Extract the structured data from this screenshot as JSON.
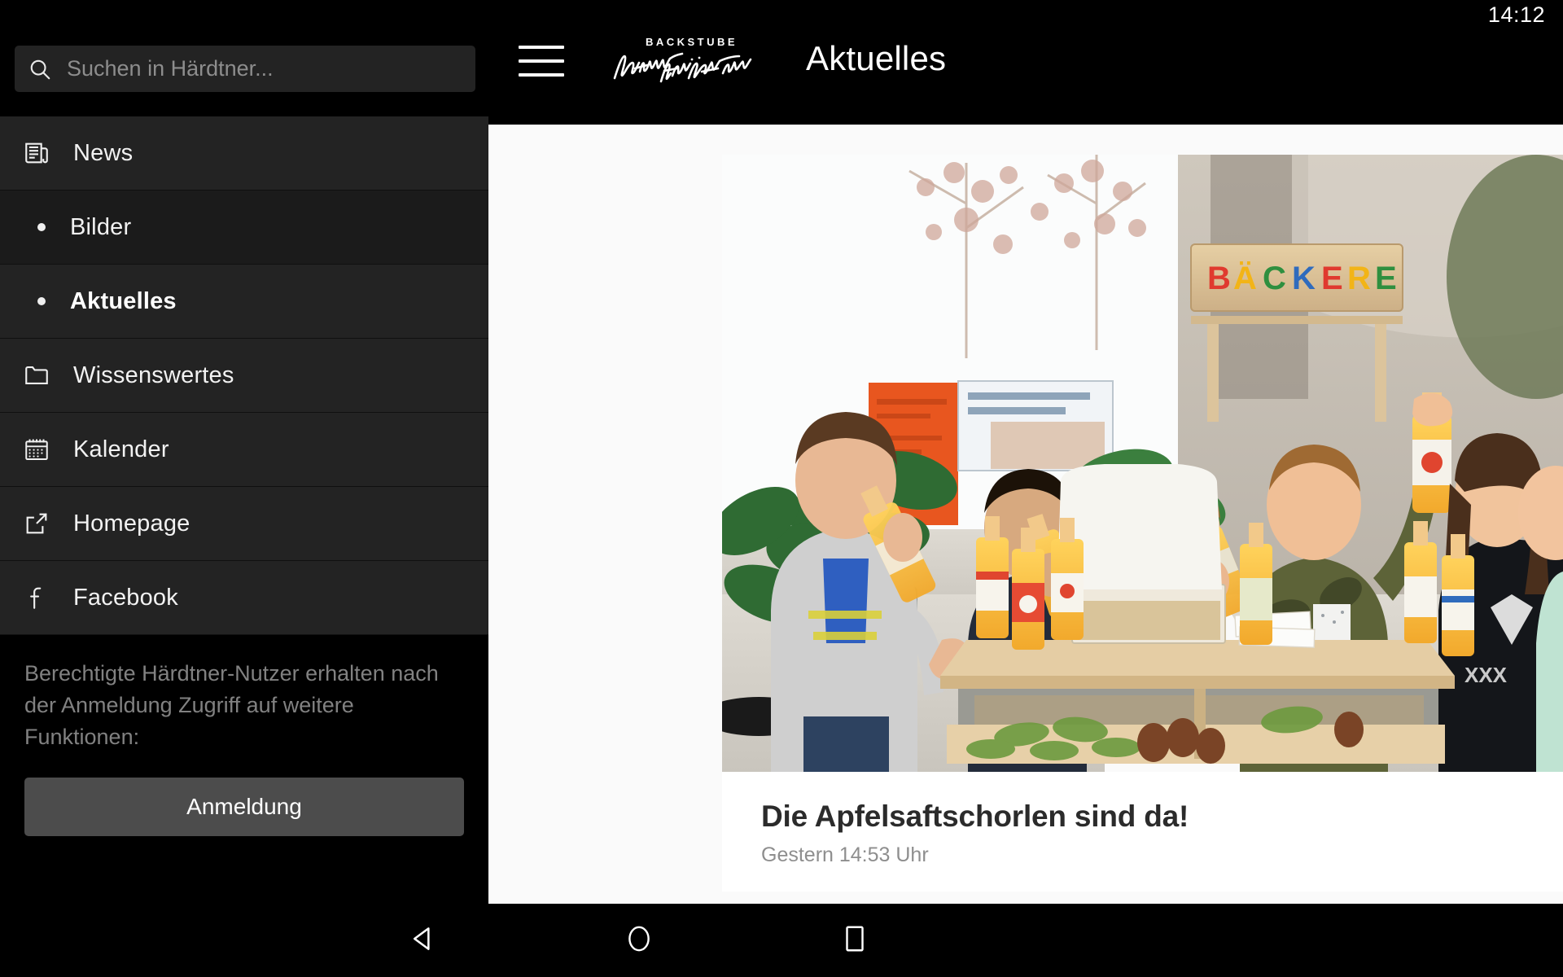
{
  "status": {
    "clock": "14:12"
  },
  "search": {
    "placeholder": "Suchen in Härdtner...",
    "icon": "search-icon"
  },
  "sidebar": {
    "items": [
      {
        "label": "News",
        "icon": "newspaper-icon",
        "type": "top",
        "active": false,
        "shade": "light"
      },
      {
        "label": "Bilder",
        "icon": "bullet-icon",
        "type": "sub",
        "active": false,
        "shade": "dark"
      },
      {
        "label": "Aktuelles",
        "icon": "bullet-icon",
        "type": "sub",
        "active": true,
        "shade": "light"
      },
      {
        "label": "Wissenswertes",
        "icon": "folder-icon",
        "type": "top",
        "active": false,
        "shade": "light"
      },
      {
        "label": "Kalender",
        "icon": "calendar-icon",
        "type": "top",
        "active": false,
        "shade": "light"
      },
      {
        "label": "Homepage",
        "icon": "external-link-icon",
        "type": "top",
        "active": false,
        "shade": "light"
      },
      {
        "label": "Facebook",
        "icon": "facebook-icon",
        "type": "top",
        "active": false,
        "shade": "light"
      }
    ],
    "promo_text": "Berechtigte Härdtner-Nutzer erhalten nach der Anmeldung Zugriff auf weitere Funktionen:",
    "login_label": "Anmeldung"
  },
  "header": {
    "menu_icon": "hamburger-icon",
    "logo_top": "BACKSTUBE",
    "logo_signature": "Hermann Härdtner",
    "title": "Aktuelles"
  },
  "article": {
    "title": "Die Apfelsaftschorlen sind da!",
    "date": "Gestern 14:53 Uhr",
    "photo_alt": "Schulkinder trinken Apfelsaftschorle an einem Holzstand in der Bäckerei",
    "photo_sign_text": "BÄCKEREI"
  },
  "navbar": {
    "back_icon": "triangle-back-icon",
    "home_icon": "circle-home-icon",
    "recents_icon": "square-recents-icon"
  },
  "colors": {
    "window_bg": "#000000",
    "sidebar_item": "#232323",
    "sidebar_item_dark": "#1b1b1b",
    "content_bg": "#fafafa",
    "card_bg": "#ffffff",
    "title_text": "#2b2b2b",
    "muted_text": "#8e8e8e",
    "button_bg": "#4c4c4c"
  }
}
